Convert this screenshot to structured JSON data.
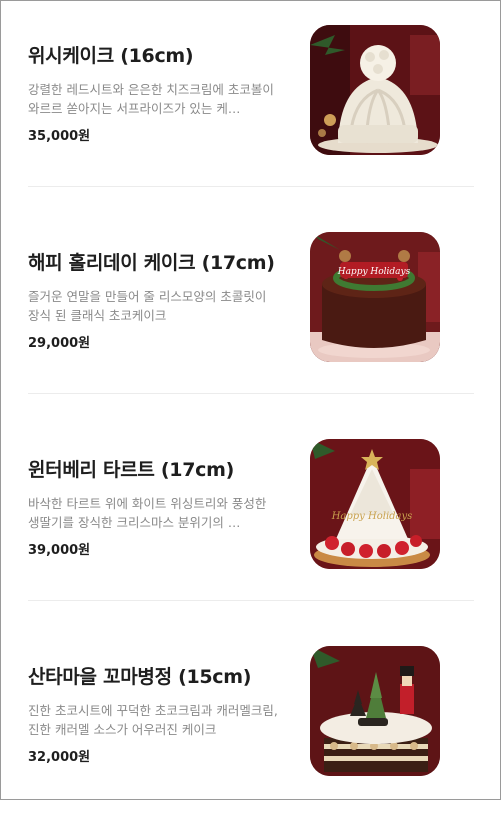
{
  "products": [
    {
      "name": "위시케이크 (16cm)",
      "description": "강렬한 레드시트와 은은한 치즈크림에 초코볼이 와르르 쏟아지는 서프라이즈가 있는 케…",
      "price": "35,000원",
      "image_icon": "wish-cake-image"
    },
    {
      "name": "해피 홀리데이 케이크 (17cm)",
      "description": "즐거운 연말을 만들어 줄 리스모양의 초콜릿이 장식 된 클래식 초코케이크",
      "price": "29,000원",
      "image_icon": "happy-holiday-cake-image",
      "image_text": "Happy Holidays"
    },
    {
      "name": "윈터베리 타르트 (17cm)",
      "description": "바삭한 타르트 위에 화이트 위싱트리와 풍성한 생딸기를 장식한 크리스마스 분위기의 …",
      "price": "39,000원",
      "image_icon": "winterberry-tart-image",
      "image_text": "Happy Holidays"
    },
    {
      "name": "산타마을 꼬마병정 (15cm)",
      "description": "진한 초코시트에 꾸덕한 초코크림과 캐러멜크림, 진한 캐러멜 소스가 어우러진 케이크",
      "price": "32,000원",
      "image_icon": "santa-village-cake-image"
    }
  ],
  "colors": {
    "title": "#1e1e1e",
    "description": "#8a8a8a",
    "divider": "#ececec"
  }
}
